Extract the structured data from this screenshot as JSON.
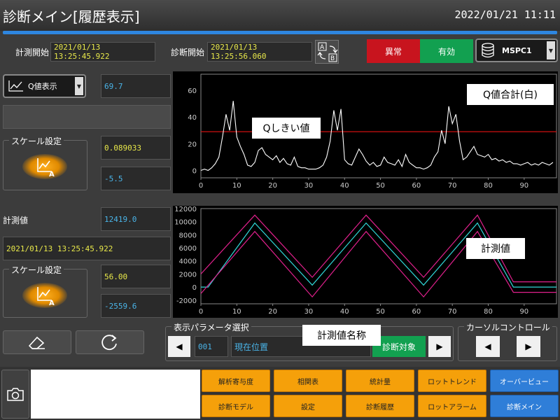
{
  "header": {
    "title": "診断メイン[履歴表示]",
    "datetime": "2022/01/21 11:11"
  },
  "info_row": {
    "measure_start_label": "計測開始",
    "measure_start_value": "2021/01/13 13:25:45.922",
    "diag_start_label": "診断開始",
    "diag_start_value": "2021/01/13 13:25:56.060",
    "swap_icon": "ab-swap-icon",
    "status_abnormal": "異常",
    "status_valid": "有効",
    "db_select": "MSPC1",
    "db_icon": "database-icon"
  },
  "q_panel": {
    "mode_select": "Q値表示",
    "q_value": "69.7",
    "scale_title": "スケール設定",
    "scale_max": "0.089033",
    "scale_min": "-5.5"
  },
  "m_panel": {
    "label": "計測値",
    "value": "12419.0",
    "timestamp": "2021/01/13 13:25:45.922",
    "scale_title": "スケール設定",
    "scale_max": "56.00",
    "scale_min": "-2559.6"
  },
  "param_select": {
    "title": "表示パラメータ選択",
    "number": "001",
    "name": "現在位置",
    "target_btn": "診断対象",
    "name_label": "計測値名称"
  },
  "cursor": {
    "title": "カーソルコントロール"
  },
  "nav": {
    "row1": [
      "解析寄与度",
      "相関表",
      "統計量",
      "ロットトレンド",
      "オーバービュー"
    ],
    "row2": [
      "診断モデル",
      "設定",
      "診断履歴",
      "ロットアラーム",
      "診断メイン"
    ]
  },
  "chart_data": [
    {
      "type": "line",
      "title": "",
      "xlabel": "",
      "ylabel": "",
      "xlim": [
        0,
        99
      ],
      "ylim": [
        -5.5,
        72
      ],
      "x_ticks": [
        0,
        10,
        20,
        30,
        40,
        50,
        60,
        70,
        80,
        90
      ],
      "y_ticks": [
        0,
        20,
        40,
        60
      ],
      "label_main": "Q値合計(白)",
      "label_threshold": "Qしきい値",
      "threshold": 29,
      "series": [
        {
          "color": "#ffffff",
          "values": [
            0,
            1,
            0,
            2,
            5,
            10,
            25,
            42,
            30,
            52,
            25,
            18,
            12,
            4,
            3,
            6,
            15,
            17,
            12,
            10,
            8,
            11,
            6,
            9,
            5,
            4,
            10,
            3,
            2,
            2,
            1,
            1,
            1,
            2,
            4,
            10,
            22,
            45,
            30,
            46,
            8,
            5,
            4,
            10,
            16,
            12,
            7,
            4,
            6,
            3,
            4,
            10,
            6,
            5,
            4,
            8,
            3,
            12,
            6,
            4,
            2,
            2,
            1,
            2,
            4,
            10,
            14,
            30,
            20,
            48,
            35,
            42,
            22,
            8,
            10,
            14,
            18,
            12,
            11,
            10,
            12,
            8,
            9,
            7,
            8,
            6,
            7,
            5,
            5,
            4,
            5,
            6,
            4,
            5,
            4,
            6,
            5,
            4,
            6
          ]
        },
        {
          "color": "#d01010",
          "values": []
        }
      ]
    },
    {
      "type": "line",
      "title": "",
      "xlabel": "",
      "ylabel": "",
      "xlim": [
        0,
        99
      ],
      "ylim": [
        -2559.6,
        12000
      ],
      "x_ticks": [
        0,
        10,
        20,
        30,
        40,
        50,
        60,
        70,
        80,
        90
      ],
      "y_ticks": [
        -2000,
        0,
        2000,
        4000,
        6000,
        8000,
        10000,
        12000
      ],
      "label_main": "計測値",
      "series": [
        {
          "name": "upper",
          "color": "#e0208c",
          "points": [
            [
              0,
              2000
            ],
            [
              15,
              11000
            ],
            [
              31,
              1500
            ],
            [
              46,
              11000
            ],
            [
              62,
              1500
            ],
            [
              77,
              11000
            ],
            [
              87,
              800
            ],
            [
              99,
              800
            ]
          ]
        },
        {
          "name": "value",
          "color": "#30d8d8",
          "points": [
            [
              0,
              0
            ],
            [
              2,
              0
            ],
            [
              15,
              9800
            ],
            [
              31,
              300
            ],
            [
              46,
              9800
            ],
            [
              62,
              300
            ],
            [
              77,
              9800
            ],
            [
              87,
              0
            ],
            [
              99,
              0
            ]
          ]
        },
        {
          "name": "lower",
          "color": "#e0208c",
          "points": [
            [
              0,
              -1000
            ],
            [
              15,
              8500
            ],
            [
              31,
              -1500
            ],
            [
              46,
              8500
            ],
            [
              62,
              -1500
            ],
            [
              77,
              8500
            ],
            [
              87,
              -800
            ],
            [
              99,
              -800
            ]
          ]
        }
      ]
    }
  ]
}
